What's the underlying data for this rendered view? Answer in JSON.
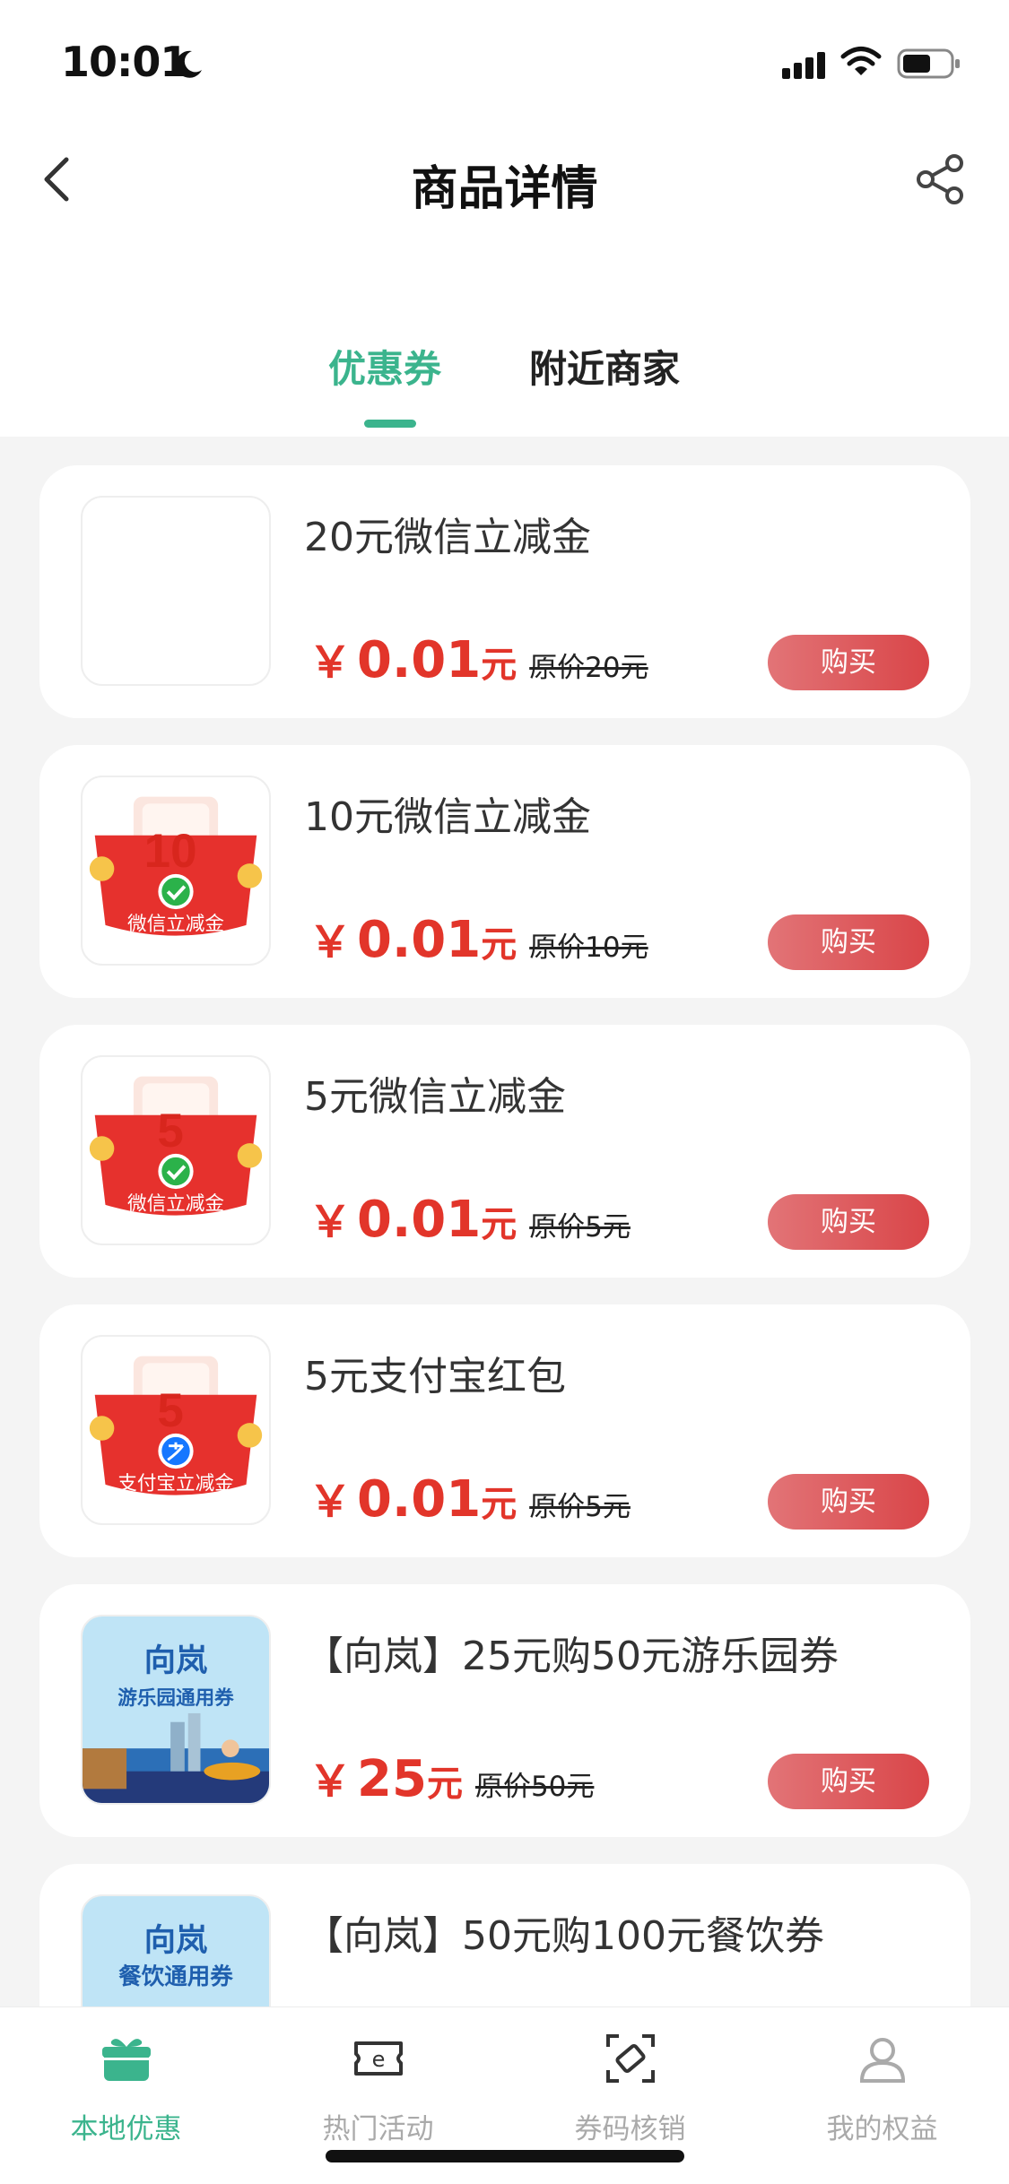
{
  "status_bar": {
    "time": "10:01"
  },
  "header": {
    "title": "商品详情"
  },
  "tabs": [
    {
      "label": "优惠券",
      "active": true
    },
    {
      "label": "附近商家",
      "active": false
    }
  ],
  "products": [
    {
      "name": "20元微信立减金",
      "currency": "￥",
      "price": "0.01",
      "unit": "元",
      "original": "原价20元",
      "buy_label": "购买",
      "image": "blank",
      "badge_number": ""
    },
    {
      "name": "10元微信立减金",
      "currency": "￥",
      "price": "0.01",
      "unit": "元",
      "original": "原价10元",
      "buy_label": "购买",
      "image": "wechat-red-envelope",
      "badge_number": "10",
      "badge_caption": "微信立减金"
    },
    {
      "name": "5元微信立减金",
      "currency": "￥",
      "price": "0.01",
      "unit": "元",
      "original": "原价5元",
      "buy_label": "购买",
      "image": "wechat-red-envelope",
      "badge_number": "5",
      "badge_caption": "微信立减金"
    },
    {
      "name": "5元支付宝红包",
      "currency": "￥",
      "price": "0.01",
      "unit": "元",
      "original": "原价5元",
      "buy_label": "购买",
      "image": "alipay-red-envelope",
      "badge_number": "5",
      "badge_caption": "支付宝立减金"
    },
    {
      "name": "【向岚】25元购50元游乐园券",
      "currency": "￥",
      "price": "25",
      "unit": "元",
      "original": "原价50元",
      "buy_label": "购买",
      "image": "xianglan-park",
      "banner_brand": "向岚",
      "banner_caption": "游乐园通用券"
    },
    {
      "name": "【向岚】50元购100元餐饮券",
      "currency": "￥",
      "price": "",
      "unit": "",
      "original": "",
      "buy_label": "",
      "image": "xianglan-food",
      "banner_brand": "向岚",
      "banner_caption": "餐饮通用券"
    }
  ],
  "tabbar": [
    {
      "label": "本地优惠",
      "icon": "gift-icon",
      "active": true
    },
    {
      "label": "热门活动",
      "icon": "ticket-e-icon",
      "active": false
    },
    {
      "label": "券码核销",
      "icon": "scan-ticket-icon",
      "active": false
    },
    {
      "label": "我的权益",
      "icon": "user-icon",
      "active": false
    }
  ],
  "colors": {
    "accent": "#3bb48d",
    "price": "#e2352a",
    "buy_button": "#d94548"
  }
}
